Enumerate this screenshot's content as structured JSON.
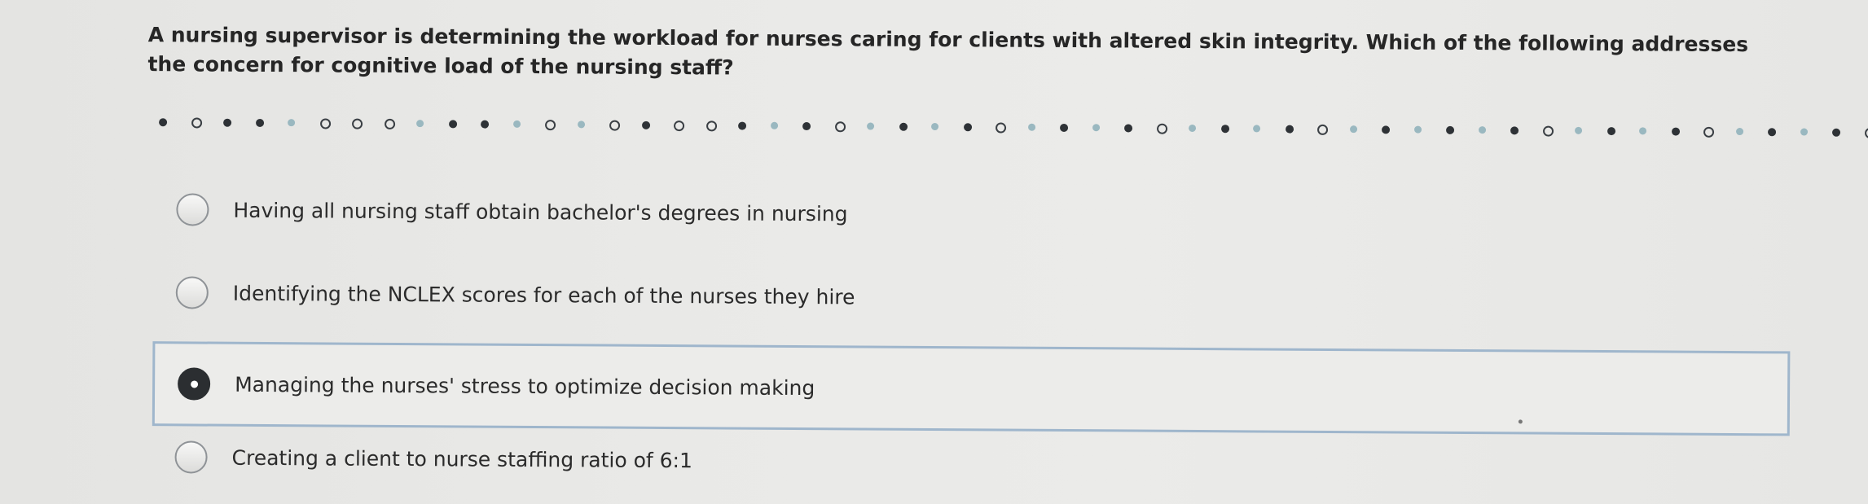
{
  "question": {
    "text": "A nursing supervisor is determining the workload for nurses caring for clients with altered skin integrity. Which of the following addresses the concern for cognitive load of the nursing staff?"
  },
  "options": [
    {
      "label": "Having all nursing staff obtain bachelor's degrees in nursing",
      "selected": false
    },
    {
      "label": "Identifying the NCLEX scores for each of the nurses they hire",
      "selected": false
    },
    {
      "label": "Managing the nurses' stress to optimize decision making",
      "selected": true
    },
    {
      "label": "Creating a client to nurse staffing ratio of 6:1",
      "selected": false
    }
  ],
  "colors": {
    "selected_border": "#9fb6cc",
    "radio_checked": "#2b2e31",
    "text": "#2b2b2b"
  }
}
